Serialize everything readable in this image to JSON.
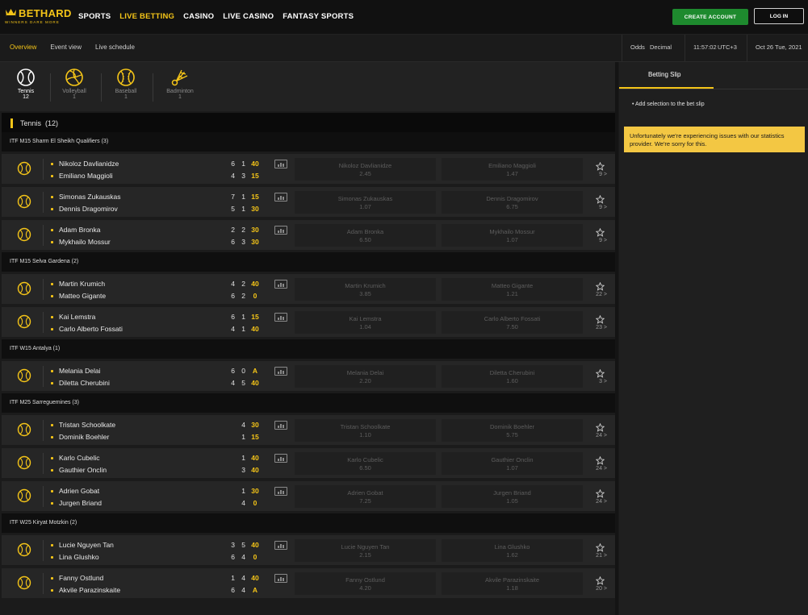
{
  "brand": {
    "name": "BETHARD",
    "tagline": "WINNERS DARE MORE",
    "accent": "#f5c518"
  },
  "nav": [
    {
      "label": "SPORTS",
      "active": false
    },
    {
      "label": "LIVE BETTING",
      "active": true
    },
    {
      "label": "CASINO",
      "active": false
    },
    {
      "label": "LIVE CASINO",
      "active": false
    },
    {
      "label": "FANTASY SPORTS",
      "active": false
    }
  ],
  "header": {
    "create_account": "CREATE ACCOUNT",
    "login": "LOG IN"
  },
  "subnav": {
    "overview": "Overview",
    "event_view": "Event view",
    "live_schedule": "Live schedule"
  },
  "info": {
    "odds_label": "Odds",
    "odds_format": "Decimal",
    "time": "11:57:02",
    "tz": "UTC+3",
    "date": "Oct 26 Tue, 2021"
  },
  "sports": [
    {
      "name": "Tennis",
      "count": "12",
      "icon": "tennis-ball-icon"
    },
    {
      "name": "Volleyball",
      "count": "1",
      "icon": "volleyball-icon"
    },
    {
      "name": "Baseball",
      "count": "1",
      "icon": "baseball-icon"
    },
    {
      "name": "Badminton",
      "count": "1",
      "icon": "shuttlecock-icon"
    }
  ],
  "section": {
    "title": "Tennis",
    "count": "(12)"
  },
  "leagues": [
    {
      "name": "ITF M15 Sharm El Sheikh Qualifiers (3)",
      "matches": [
        {
          "p1": "Nikoloz Davlianidze",
          "p2": "Emiliano Maggioli",
          "s1a": "6",
          "s1b": "1",
          "pt1": "40",
          "s2a": "4",
          "s2b": "3",
          "pt2": "15",
          "o1": "2.45",
          "o2": "1.47",
          "more": "9 >"
        },
        {
          "p1": "Simonas Zukauskas",
          "p2": "Dennis Dragomirov",
          "s1a": "7",
          "s1b": "1",
          "pt1": "15",
          "s2a": "5",
          "s2b": "1",
          "pt2": "30",
          "o1": "1.07",
          "o2": "6.75",
          "more": "9 >"
        },
        {
          "p1": "Adam Bronka",
          "p2": "Mykhailo Mossur",
          "s1a": "2",
          "s1b": "2",
          "pt1": "30",
          "s2a": "6",
          "s2b": "3",
          "pt2": "30",
          "o1": "6.50",
          "o2": "1.07",
          "more": "9 >"
        }
      ]
    },
    {
      "name": "ITF M15 Selva Gardena (2)",
      "matches": [
        {
          "p1": "Martin Krumich",
          "p2": "Matteo Gigante",
          "s1a": "4",
          "s1b": "2",
          "pt1": "40",
          "s2a": "6",
          "s2b": "2",
          "pt2": "0",
          "o1": "3.85",
          "o2": "1.21",
          "more": "22 >"
        },
        {
          "p1": "Kai Lemstra",
          "p2": "Carlo Alberto Fossati",
          "s1a": "6",
          "s1b": "1",
          "pt1": "15",
          "s2a": "4",
          "s2b": "1",
          "pt2": "40",
          "o1": "1.04",
          "o2": "7.50",
          "more": "23 >"
        }
      ]
    },
    {
      "name": "ITF W15 Antalya (1)",
      "matches": [
        {
          "p1": "Melania Delai",
          "p2": "Diletta Cherubini",
          "s1a": "6",
          "s1b": "0",
          "pt1": "A",
          "s2a": "4",
          "s2b": "5",
          "pt2": "40",
          "o1": "2.20",
          "o2": "1.60",
          "more": "3 >"
        }
      ]
    },
    {
      "name": "ITF M25 Sarreguemines (3)",
      "matches": [
        {
          "p1": "Tristan Schoolkate",
          "p2": "Dominik Boehler",
          "s1a": "",
          "s1b": "4",
          "pt1": "30",
          "s2a": "",
          "s2b": "1",
          "pt2": "15",
          "o1": "1.10",
          "o2": "5.75",
          "more": "24 >"
        },
        {
          "p1": "Karlo Cubelic",
          "p2": "Gauthier Onclin",
          "s1a": "",
          "s1b": "1",
          "pt1": "40",
          "s2a": "",
          "s2b": "3",
          "pt2": "40",
          "o1": "6.50",
          "o2": "1.07",
          "more": "24 >"
        },
        {
          "p1": "Adrien Gobat",
          "p2": "Jurgen Briand",
          "s1a": "",
          "s1b": "1",
          "pt1": "30",
          "s2a": "",
          "s2b": "4",
          "pt2": "0",
          "o1": "7.25",
          "o2": "1.05",
          "more": "24 >"
        }
      ]
    },
    {
      "name": "ITF W25 Kiryat Motzkin (2)",
      "matches": [
        {
          "p1": "Lucie Nguyen Tan",
          "p2": "Lina Glushko",
          "s1a": "3",
          "s1b": "5",
          "pt1": "40",
          "s2a": "6",
          "s2b": "4",
          "pt2": "0",
          "o1": "2.15",
          "o2": "1.62",
          "more": "21 >"
        },
        {
          "p1": "Fanny Ostlund",
          "p2": "Akvile Parazinskaite",
          "s1a": "1",
          "s1b": "4",
          "pt1": "40",
          "s2a": "6",
          "s2b": "4",
          "pt2": "A",
          "o1": "4.20",
          "o2": "1.18",
          "more": "20 >"
        }
      ]
    }
  ],
  "slip": {
    "tab": "Betting Slip",
    "add": "• Add selection to the bet slip",
    "notice": "Unfortunately we're experiencing issues with our statistics provider. We're sorry for this."
  }
}
